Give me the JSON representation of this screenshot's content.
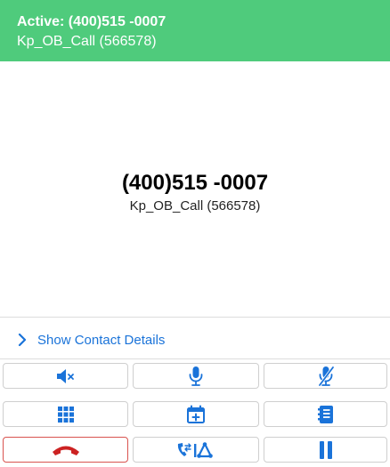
{
  "header": {
    "status_line": "Active: (400)515 -0007",
    "campaign_line": "Kp_OB_Call (566578)",
    "background_color": "#4fcb7c"
  },
  "caller": {
    "number": "(400)515 -0007",
    "campaign": "Kp_OB_Call (566578)"
  },
  "contact": {
    "toggle_label": "Show Contact Details"
  },
  "controls": {
    "icon_color": "#1a73d9",
    "hangup_color": "#cc2222",
    "row1": [
      "mute-speaker-icon",
      "microphone-icon",
      "microphone-muted-icon"
    ],
    "row2": [
      "dialpad-icon",
      "calendar-add-icon",
      "notes-icon"
    ],
    "row3": [
      "hangup-icon",
      "transfer-conference-icon",
      "hold-icon"
    ]
  }
}
